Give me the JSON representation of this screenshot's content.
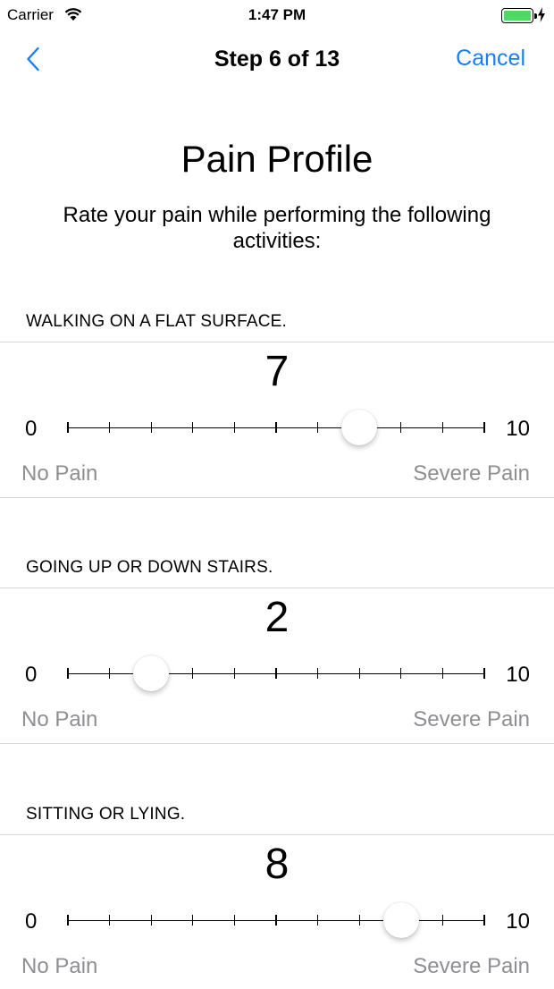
{
  "status_bar": {
    "carrier": "Carrier",
    "time": "1:47 PM",
    "battery_level": 1.0
  },
  "nav": {
    "title": "Step 6 of 13",
    "cancel_label": "Cancel",
    "back_icon": "chevron-left-icon"
  },
  "header": {
    "title": "Pain Profile",
    "subtitle": "Rate your pain while performing the following activities:"
  },
  "questions": [
    {
      "label": "WALKING ON A FLAT SURFACE.",
      "value": 7,
      "min": 0,
      "max": 10,
      "min_label": "No Pain",
      "max_label": "Severe Pain",
      "value_text": "7",
      "min_text": "0",
      "max_text": "10"
    },
    {
      "label": "GOING UP OR DOWN STAIRS.",
      "value": 2,
      "min": 0,
      "max": 10,
      "min_label": "No Pain",
      "max_label": "Severe Pain",
      "value_text": "2",
      "min_text": "0",
      "max_text": "10"
    },
    {
      "label": "SITTING OR LYING.",
      "value": 8,
      "min": 0,
      "max": 10,
      "min_label": "No Pain",
      "max_label": "Severe Pain",
      "value_text": "8",
      "min_text": "0",
      "max_text": "10"
    }
  ],
  "colors": {
    "accent": "#157efb",
    "secondary_text": "#8e8e93",
    "battery": "#4cd964"
  }
}
